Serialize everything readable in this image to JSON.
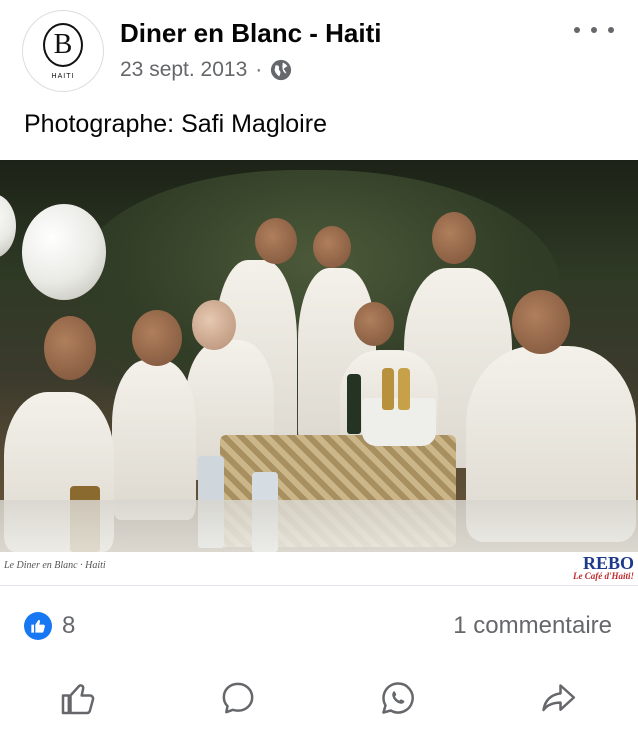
{
  "post": {
    "page_name": "Diner en Blanc - Haiti",
    "avatar_caption": "HAITI",
    "avatar_letter": "B",
    "date": "23 sept. 2013",
    "separator": "·",
    "audience_icon": "globe-icon",
    "caption": "Photographe: Safi Magloire"
  },
  "photo": {
    "watermark_left": "Le Diner en Blanc · Haiti",
    "watermark_right_title": "REBO",
    "watermark_right_sub": "Le Café d'Haiti!"
  },
  "stats": {
    "reaction_icon": "like-icon",
    "reaction_count": "8",
    "comments": "1 commentaire"
  },
  "actions": [
    {
      "name": "like",
      "icon": "thumbs-up-icon"
    },
    {
      "name": "comment",
      "icon": "comment-bubble-icon"
    },
    {
      "name": "whatsapp",
      "icon": "whatsapp-icon"
    },
    {
      "name": "share",
      "icon": "share-arrow-icon"
    }
  ],
  "colors": {
    "accent": "#1877f2",
    "secondary_text": "#65676b",
    "primary_text": "#050505"
  }
}
